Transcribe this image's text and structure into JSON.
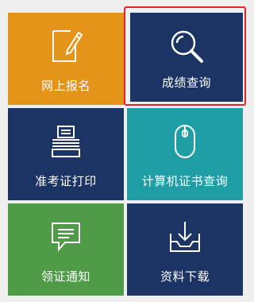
{
  "tiles": [
    {
      "label": "网上报名",
      "icon": "edit-document-icon",
      "color": "#e39419"
    },
    {
      "label": "成绩查询",
      "icon": "search-icon",
      "color": "#1c3463",
      "selected": true
    },
    {
      "label": "准考证打印",
      "icon": "printer-icon",
      "color": "#1c3463"
    },
    {
      "label": "计算机证书查询",
      "icon": "mouse-icon",
      "color": "#1f9ea6"
    },
    {
      "label": "领证通知",
      "icon": "message-icon",
      "color": "#4f9b48"
    },
    {
      "label": "资料下载",
      "icon": "download-tray-icon",
      "color": "#1c3463"
    }
  ],
  "selection_color": "#e0232c"
}
